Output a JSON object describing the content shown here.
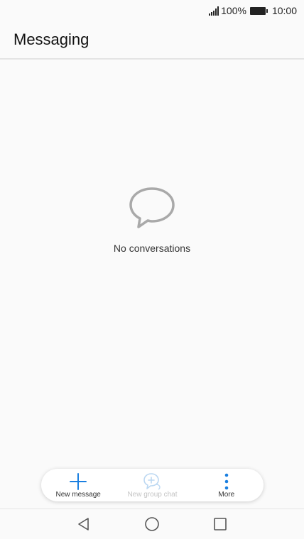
{
  "status": {
    "battery_percent": "100%",
    "time": "10:00"
  },
  "header": {
    "title": "Messaging"
  },
  "empty_state": {
    "icon": "speech-bubble-icon",
    "text": "No conversations"
  },
  "toolbar": {
    "items": [
      {
        "label": "New message",
        "icon": "plus-icon",
        "enabled": true
      },
      {
        "label": "New group chat",
        "icon": "group-chat-icon",
        "enabled": false
      },
      {
        "label": "More",
        "icon": "more-vertical-icon",
        "enabled": true
      }
    ]
  },
  "nav": {
    "buttons": [
      "back-icon",
      "home-icon",
      "recents-icon"
    ]
  },
  "colors": {
    "accent": "#1a7fe0",
    "disabled": "#c4c4c4",
    "empty_icon": "#a9a9a9"
  }
}
